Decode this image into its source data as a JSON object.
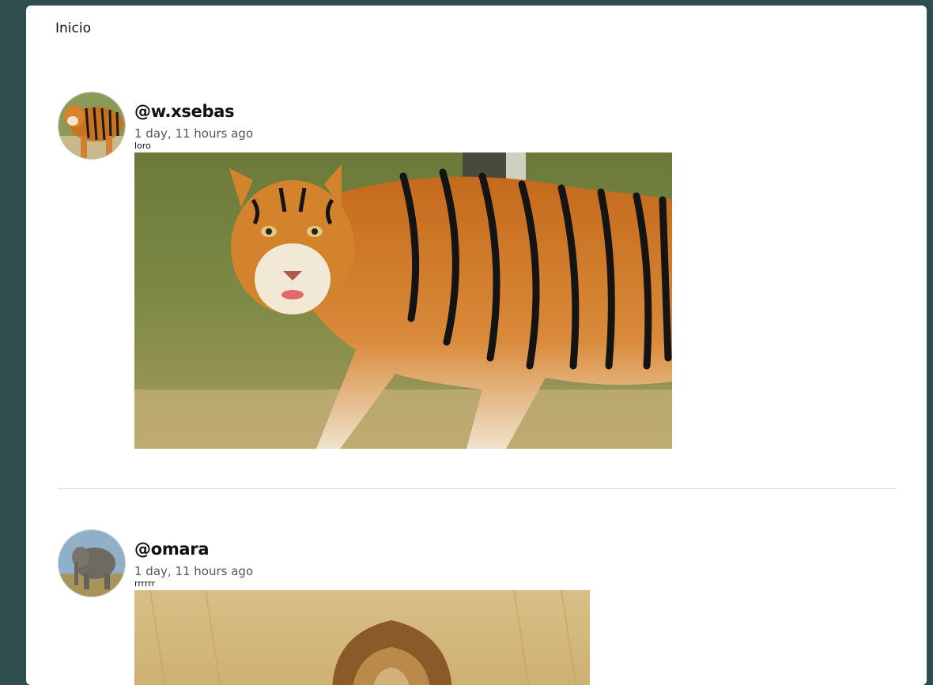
{
  "nav": {
    "title": "Inicio"
  },
  "posts": [
    {
      "username": "@w.xsebas",
      "time": "1 day, 11 hours ago",
      "caption": "loro",
      "avatar_icon": "tiger-avatar",
      "photo_subject": "tiger"
    },
    {
      "username": "@omara",
      "time": "1 day, 11 hours ago",
      "caption": "rrrrrr",
      "avatar_icon": "elephant-avatar",
      "photo_subject": "lion"
    }
  ],
  "colors": {
    "background": "#2f4f4f",
    "card": "#ffffff",
    "divider": "#dcdcdc"
  }
}
